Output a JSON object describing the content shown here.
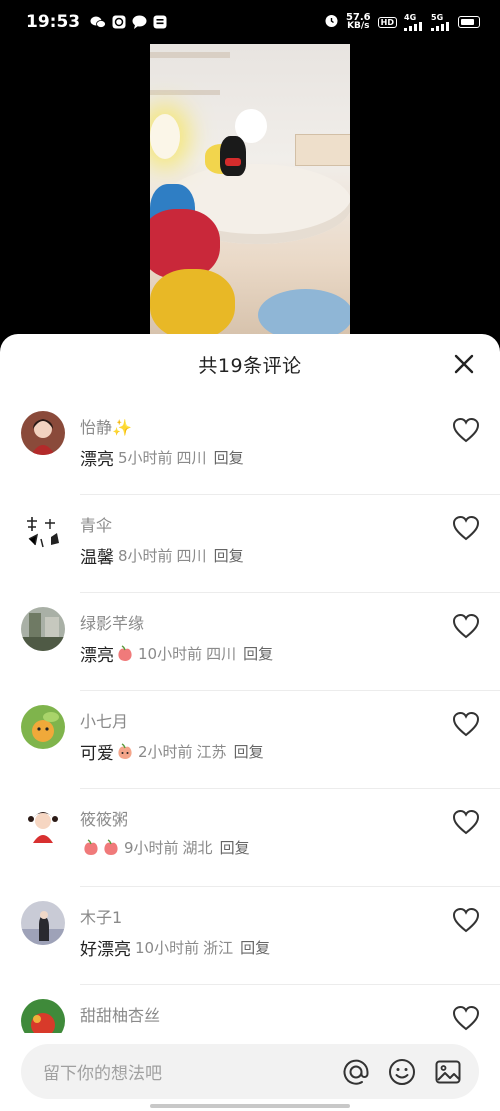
{
  "status_bar": {
    "time": "19:53",
    "net_speed_value": "57.6",
    "net_speed_unit": "KB/s",
    "hd_label": "HD",
    "sig1_label": "4G",
    "sig2_label": "5G"
  },
  "comments_panel": {
    "title": "共19条评论",
    "comments": [
      {
        "name": "怡静✨",
        "text": "漂亮",
        "time": "5小时前",
        "location": "四川",
        "reply": "回复",
        "emoji_count": 0
      },
      {
        "name": "青伞",
        "text": "温馨",
        "time": "8小时前",
        "location": "四川",
        "reply": "回复",
        "emoji_count": 0
      },
      {
        "name": "绿影芊缘",
        "text": "漂亮",
        "time": "10小时前",
        "location": "四川",
        "reply": "回复",
        "emoji_count": 1
      },
      {
        "name": "小七月",
        "text": "可爱",
        "time": "2小时前",
        "location": "江苏",
        "reply": "回复",
        "emoji_count": 1
      },
      {
        "name": "筱筱粥",
        "text": "",
        "time": "9小时前",
        "location": "湖北",
        "reply": "回复",
        "emoji_count": 2
      },
      {
        "name": "木子1",
        "text": "好漂亮",
        "time": "10小时前",
        "location": "浙江",
        "reply": "回复",
        "emoji_count": 0
      },
      {
        "name": "甜甜柚杏丝",
        "text": "",
        "time": "",
        "location": "",
        "reply": "",
        "emoji_count": 0
      }
    ]
  },
  "input": {
    "placeholder": "留下你的想法吧",
    "mention_icon": "at-icon",
    "emoji_icon": "smiley-icon",
    "image_icon": "image-icon"
  },
  "colors": {
    "heart_stroke": "#333333",
    "meta_gray": "#8a8a8a",
    "peach": "#f07a7a"
  }
}
